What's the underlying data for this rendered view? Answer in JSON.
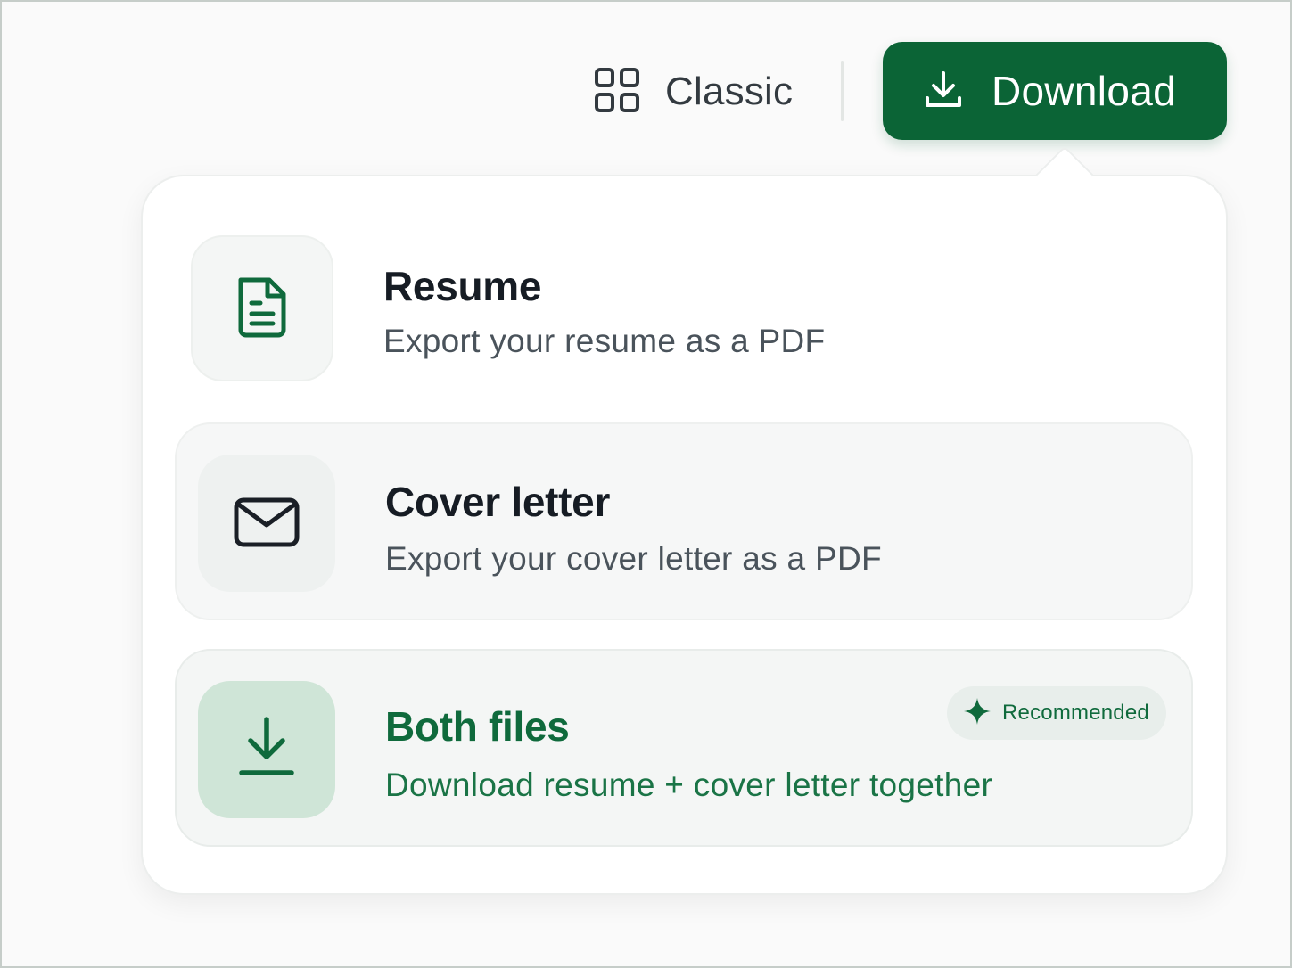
{
  "toolbar": {
    "classic_label": "Classic",
    "download_label": "Download"
  },
  "menu": {
    "options": [
      {
        "title": "Resume",
        "description": "Export your resume as a PDF",
        "icon": "document-icon"
      },
      {
        "title": "Cover letter",
        "description": "Export your cover letter as a PDF",
        "icon": "mail-icon"
      },
      {
        "title": "Both files",
        "description": "Download resume + cover letter together",
        "icon": "download-icon",
        "badge": "Recommended",
        "badge_icon": "sparkle-icon"
      }
    ]
  },
  "colors": {
    "brand_green": "#0b6436",
    "accent_green_text": "#0f6a3c",
    "icon_tile_green": "#cfe5d7"
  }
}
